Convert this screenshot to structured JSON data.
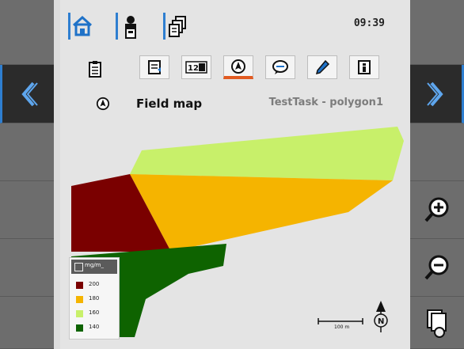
{
  "header": {
    "clock": "09:39"
  },
  "tabs": [
    {
      "name": "tab-document",
      "icon": "document-tab-icon",
      "active": false
    },
    {
      "name": "tab-counters",
      "icon": "counter-123-icon",
      "active": false
    },
    {
      "name": "tab-field-map",
      "icon": "field-map-icon",
      "active": true
    },
    {
      "name": "tab-comments",
      "icon": "speech-bubble-icon",
      "active": false
    },
    {
      "name": "tab-edit",
      "icon": "pen-icon",
      "active": false
    },
    {
      "name": "tab-info",
      "icon": "info-icon",
      "active": false
    }
  ],
  "page": {
    "title": "Field map",
    "task_name": "TestTask - polygon1"
  },
  "legend": {
    "unit": "mg/m_",
    "items": [
      {
        "label": "200",
        "color": "#7a0000"
      },
      {
        "label": "180",
        "color": "#f5b400"
      },
      {
        "label": "160",
        "color": "#c8f06a"
      },
      {
        "label": "140",
        "color": "#0e6300"
      }
    ]
  },
  "scale": {
    "label": "100 m"
  },
  "colors": {
    "accent": "#2e7ed0",
    "active_tab": "#e25a20"
  }
}
